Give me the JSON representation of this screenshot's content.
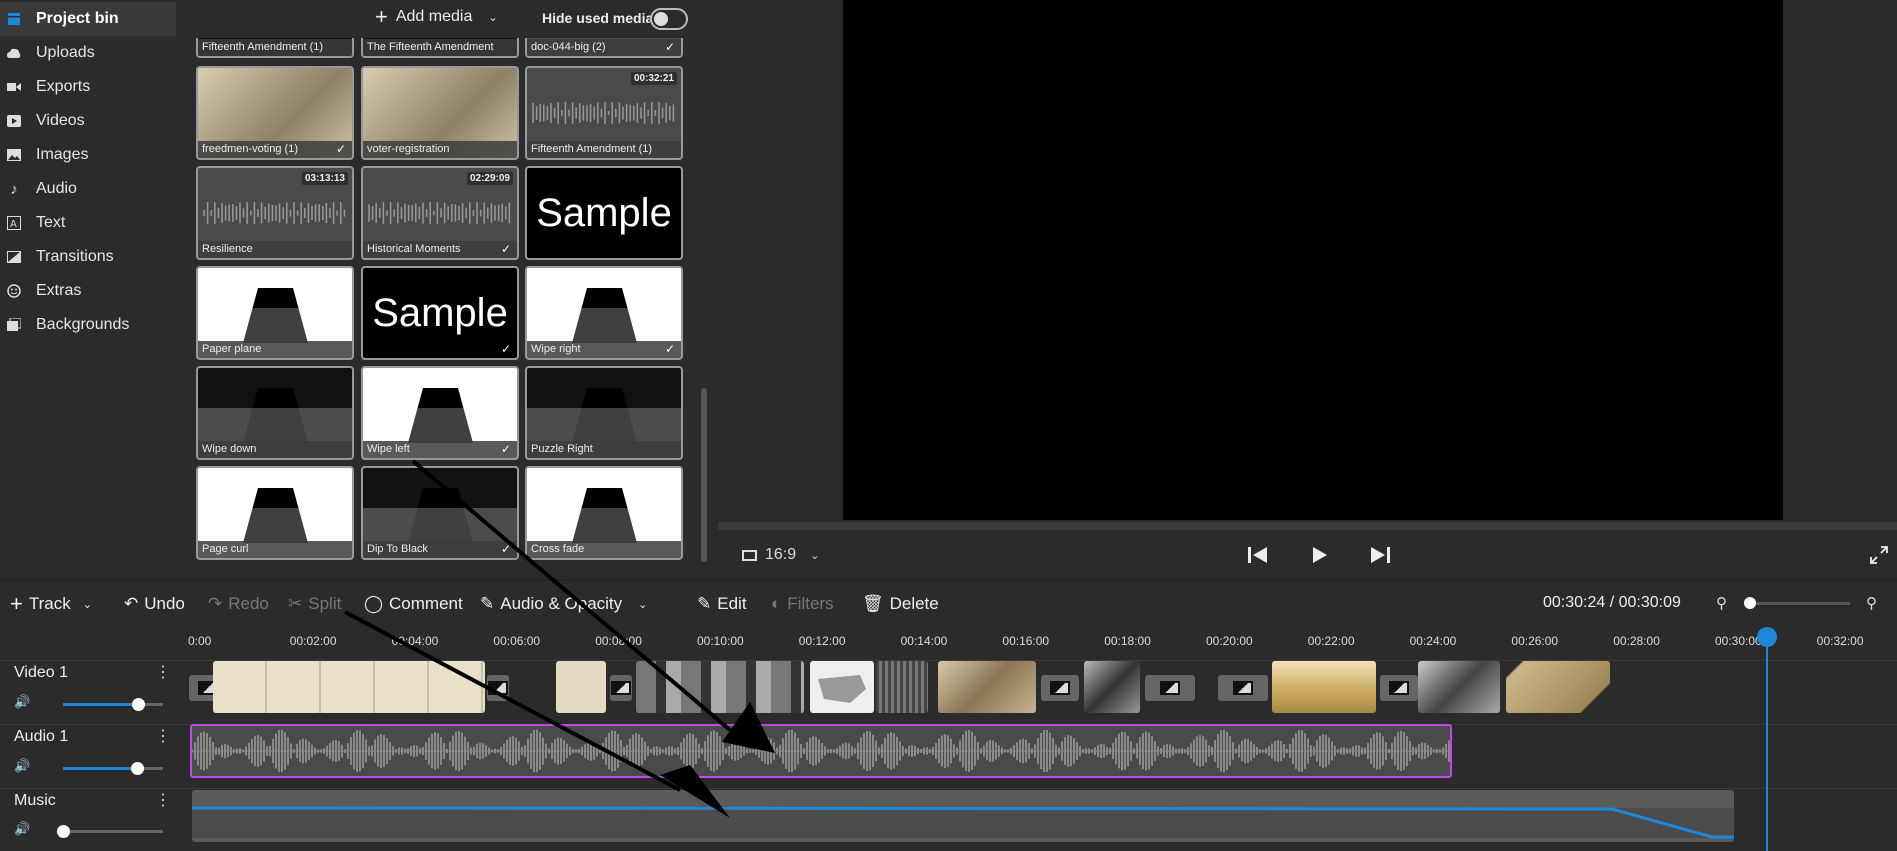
{
  "sidebar": {
    "items": [
      {
        "label": "Project bin",
        "icon": "project-bin-icon"
      },
      {
        "label": "Uploads",
        "icon": "cloud-upload-icon"
      },
      {
        "label": "Exports",
        "icon": "video-export-icon"
      },
      {
        "label": "Videos",
        "icon": "video-icon"
      },
      {
        "label": "Images",
        "icon": "image-icon"
      },
      {
        "label": "Audio",
        "icon": "music-note-icon"
      },
      {
        "label": "Text",
        "icon": "text-icon"
      },
      {
        "label": "Transitions",
        "icon": "transition-icon"
      },
      {
        "label": "Extras",
        "icon": "smiley-icon"
      },
      {
        "label": "Backgrounds",
        "icon": "backgrounds-icon"
      }
    ]
  },
  "bin": {
    "add_media": "Add media",
    "hide_used": "Hide used media",
    "top_row": [
      "Fifteenth Amendment (1)",
      "The Fifteenth Amendment",
      "doc-044-big (2)"
    ],
    "tiles": [
      {
        "label": "freedmen-voting (1)",
        "kind": "pic",
        "used": true
      },
      {
        "label": "voter-registration",
        "kind": "pic",
        "used": false
      },
      {
        "label": "Fifteenth Amendment (1)",
        "kind": "audio",
        "duration": "00:32:21",
        "used": false
      },
      {
        "label": "Resilience",
        "kind": "audio",
        "duration": "03:13:13",
        "used": false
      },
      {
        "label": "Historical Moments",
        "kind": "audio",
        "duration": "02:29:09",
        "used": true
      },
      {
        "label": "",
        "kind": "sample",
        "text": "Sample",
        "used": false
      },
      {
        "label": "Paper plane",
        "kind": "trans",
        "used": false
      },
      {
        "label": "",
        "kind": "sample",
        "text": "Sample",
        "used": true
      },
      {
        "label": "Wipe right",
        "kind": "trans",
        "used": true
      },
      {
        "label": "Wipe down",
        "kind": "trans",
        "used": false
      },
      {
        "label": "Wipe left",
        "kind": "trans",
        "used": true
      },
      {
        "label": "Puzzle Right",
        "kind": "trans",
        "used": false
      },
      {
        "label": "Page curl",
        "kind": "trans",
        "used": false
      },
      {
        "label": "Dip To Black",
        "kind": "trans",
        "used": true
      },
      {
        "label": "Cross fade",
        "kind": "trans",
        "used": false
      }
    ]
  },
  "preview": {
    "aspect": "16:9"
  },
  "toolbar": {
    "track": "Track",
    "undo": "Undo",
    "redo": "Redo",
    "split": "Split",
    "comment": "Comment",
    "audio_opacity": "Audio & Opacity",
    "edit": "Edit",
    "filters": "Filters",
    "delete": "Delete",
    "timecode": "00:30:24 / 00:30:09"
  },
  "ruler": [
    "0:00",
    "00:02:00",
    "00:04:00",
    "00:06:00",
    "00:08:00",
    "00:10:00",
    "00:12:00",
    "00:14:00",
    "00:16:00",
    "00:18:00",
    "00:20:00",
    "00:22:00",
    "00:24:00",
    "00:26:00",
    "00:28:00",
    "00:30:00",
    "00:32:00"
  ],
  "tracks": [
    {
      "name": "Video 1",
      "volume": 0.75
    },
    {
      "name": "Audio 1",
      "volume": 0.74
    },
    {
      "name": "Music",
      "volume": 0.0
    }
  ],
  "colors": {
    "accent": "#1e88d8",
    "selection": "#c048e8"
  }
}
